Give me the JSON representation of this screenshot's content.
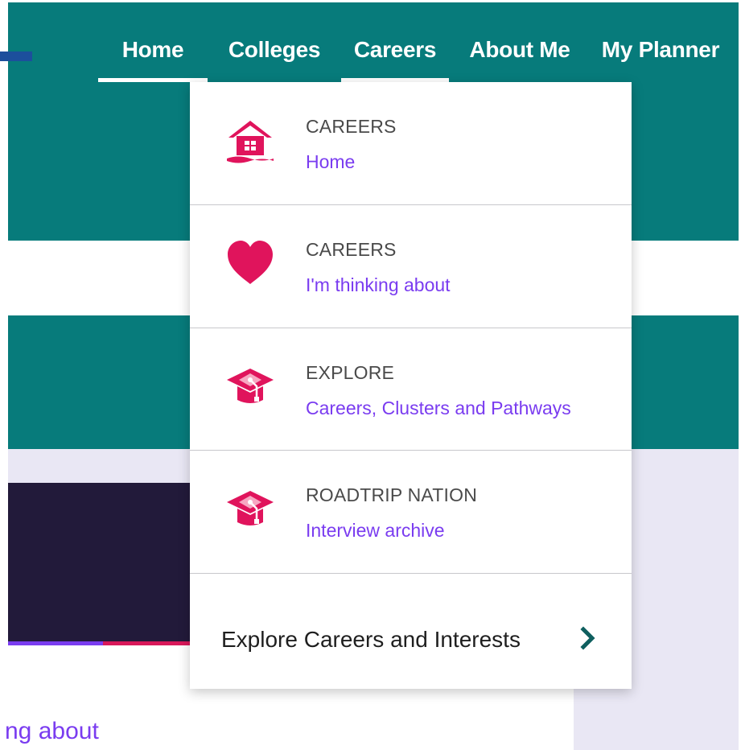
{
  "nav": {
    "items": [
      {
        "label": "Home",
        "active": true
      },
      {
        "label": "Colleges",
        "active": false
      },
      {
        "label": "Careers",
        "active": true
      },
      {
        "label": "About Me",
        "active": false
      },
      {
        "label": "My Planner",
        "active": false
      }
    ]
  },
  "dropdown": {
    "items": [
      {
        "kicker": "CAREERS",
        "link": "Home",
        "icon": "house-icon"
      },
      {
        "kicker": "CAREERS",
        "link": "I'm thinking about",
        "icon": "heart-icon"
      },
      {
        "kicker": "EXPLORE",
        "link": "Careers, Clusters and Pathways",
        "icon": "graduation-cap-icon"
      },
      {
        "kicker": "ROADTRIP NATION",
        "link": "Interview archive",
        "icon": "graduation-cap-icon"
      }
    ],
    "footer": {
      "label": "Explore Careers and Interests",
      "icon": "chevron-right-icon"
    }
  },
  "page": {
    "partial_text": "ng about"
  },
  "colors": {
    "teal": "#077b7b",
    "pink_icon": "#e0145c",
    "link_purple": "#7a3cf0",
    "lavender": "#e9e7f4",
    "dark_card": "#221a3a",
    "chevron_teal": "#0f5f5f"
  }
}
